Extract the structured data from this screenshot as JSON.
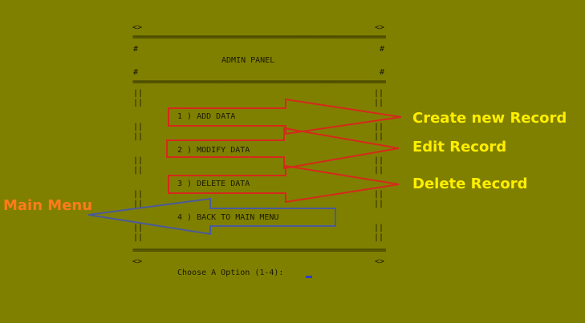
{
  "terminal": {
    "corner_tl": "<>",
    "corner_tr": "<>",
    "corner_bl": "<>",
    "corner_br": "<>",
    "hash": "#",
    "rule": "================================================================",
    "pipe": "||",
    "title": "ADMIN PANEL",
    "menu": [
      {
        "label": "1 ) ADD DATA"
      },
      {
        "label": "2 ) MODIFY DATA"
      },
      {
        "label": "3 ) DELETE DATA"
      },
      {
        "label": "4 ) BACK TO MAIN MENU"
      }
    ],
    "prompt": "Choose A Option (1-4): "
  },
  "annotations": {
    "create": "Create new Record",
    "edit": "Edit Record",
    "delete": "Delete Record",
    "main": "Main Menu"
  },
  "colors": {
    "background": "#808000",
    "callout_yellow": "#ffee00",
    "callout_orange": "#ff7a1a",
    "arrow_red": "#d42a1a",
    "arrow_blue": "#4a5a9a"
  }
}
